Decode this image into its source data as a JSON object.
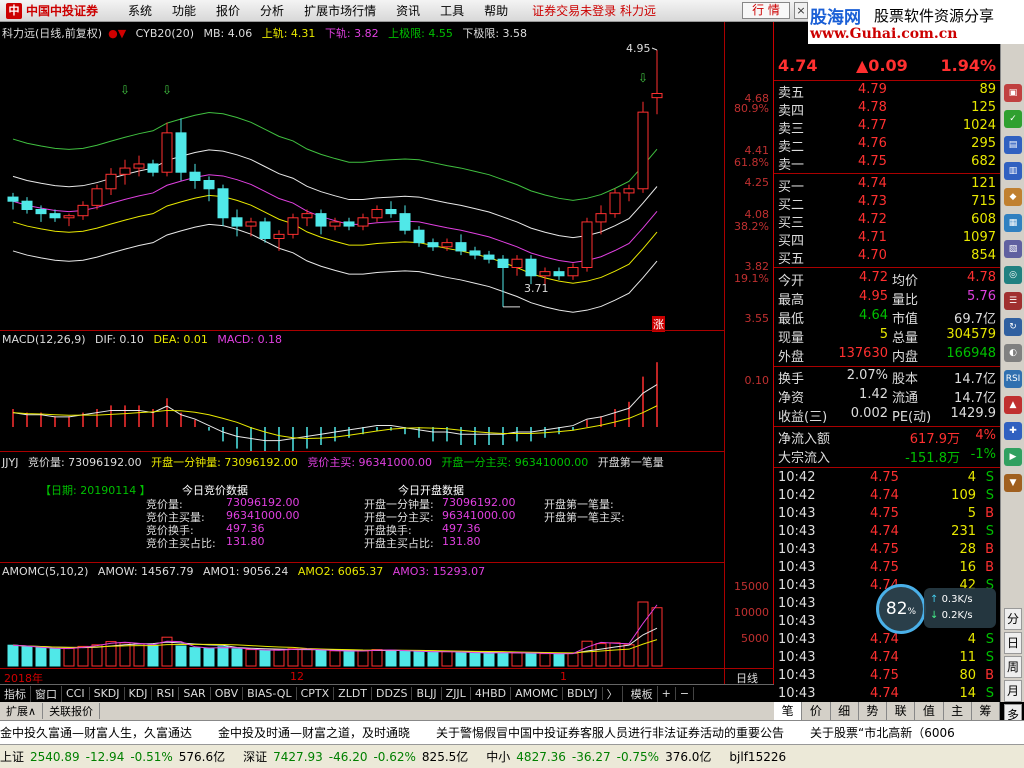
{
  "app": {
    "logo_mark": "中",
    "logo_name": "中国中投证券",
    "menus": [
      "系统",
      "功能",
      "报价",
      "分析",
      "扩展市场行情",
      "资讯",
      "工具",
      "帮助"
    ],
    "status_message": "证券交易未登录 科力远",
    "quote_button": "行 情",
    "close_button": "×"
  },
  "banner": {
    "line1": "股海网",
    "line2": "股票软件资源分享",
    "line3": "www.Guhai.com.cn"
  },
  "kline_header": {
    "title": "科力远(日线,前复权)",
    "indicator": "CYB20(20)",
    "mb": "MB: 4.06",
    "upper": "上轨: 4.31",
    "lower": "下轨: 3.82",
    "upper_limit": "上极限: 4.55",
    "lower_limit": "下极限: 3.58"
  },
  "kline_axis": {
    "labels": [
      "4.68",
      "80.9%",
      "4.41",
      "61.8%",
      "4.25",
      "4.08",
      "38.2%",
      "3.82",
      "19.1%",
      "3.55"
    ]
  },
  "kline_annotations": {
    "high_label": "4.95",
    "low_label": "3.71",
    "rise_mark": "涨"
  },
  "macd_header": {
    "name": "MACD(12,26,9)",
    "dif": "DIF: 0.10",
    "dea": "DEA: 0.01",
    "macd": "MACD: 0.18"
  },
  "macd_axis": {
    "label": "0.10"
  },
  "jjyj_header": {
    "name": "JJYJ",
    "items": [
      "竞价量: 73096192.00",
      "开盘一分钟量: 73096192.00",
      "竞价主买: 96341000.00",
      "开盘一分主买: 96341000.00",
      "开盘第一笔量"
    ]
  },
  "jjyj_panel": {
    "date_label": "【日期: 20190114  】",
    "left_title": "今日竞价数据",
    "right_title": "今日开盘数据",
    "left_rows": [
      {
        "k": "竞价量:",
        "v": "73096192.00"
      },
      {
        "k": "竞价主买量:",
        "v": "96341000.00"
      },
      {
        "k": "竞价换手:",
        "v": "497.36"
      },
      {
        "k": "竞价主买占比:",
        "v": "131.80"
      }
    ],
    "mid_rows": [
      {
        "k": "开盘一分钟量:",
        "v": "73096192.00"
      },
      {
        "k": "开盘一分主买:",
        "v": "96341000.00"
      },
      {
        "k": "开盘换手:",
        "v": "497.36"
      },
      {
        "k": "开盘主买占比:",
        "v": "131.80"
      }
    ],
    "right_rows": [
      {
        "k": "开盘第一笔量:",
        "v": ""
      },
      {
        "k": "开盘第一笔主买:",
        "v": ""
      }
    ]
  },
  "amomc_header": {
    "name": "AMOMC(5,10,2)",
    "amow": "AMOW: 14567.79",
    "amo1": "AMO1: 9056.24",
    "amo2": "AMO2: 6065.37",
    "amo3": "AMO3: 15293.07"
  },
  "amomc_axis": {
    "labels": [
      "15000",
      "10000",
      "5000"
    ]
  },
  "date_axis": {
    "left": "2018年",
    "mid": "12",
    "right": "1",
    "period": "日线"
  },
  "index_tabs": [
    "指标",
    "窗口",
    "CCI",
    "SKDJ",
    "KDJ",
    "RSI",
    "SAR",
    "OBV",
    "BIAS-QL",
    "CPTX",
    "ZLDT",
    "DDZS",
    "BLJJ",
    "ZJJL",
    "4HBD",
    "AMOMC",
    "BDLYJ",
    "〉",
    "模板",
    "+",
    "−"
  ],
  "sub_tabs": [
    "扩展∧",
    "关联报价"
  ],
  "quote": {
    "price": "4.74",
    "change": "▲0.09",
    "pct": "1.94%",
    "sells": [
      {
        "label": "卖五",
        "price": "4.79",
        "vol": "89"
      },
      {
        "label": "卖四",
        "price": "4.78",
        "vol": "125"
      },
      {
        "label": "卖三",
        "price": "4.77",
        "vol": "1024"
      },
      {
        "label": "卖二",
        "price": "4.76",
        "vol": "295"
      },
      {
        "label": "卖一",
        "price": "4.75",
        "vol": "682"
      }
    ],
    "buys": [
      {
        "label": "买一",
        "price": "4.74",
        "vol": "121"
      },
      {
        "label": "买二",
        "price": "4.73",
        "vol": "715"
      },
      {
        "label": "买三",
        "price": "4.72",
        "vol": "608"
      },
      {
        "label": "买四",
        "price": "4.71",
        "vol": "1097"
      },
      {
        "label": "买五",
        "price": "4.70",
        "vol": "854"
      }
    ],
    "stats": [
      {
        "k1": "今开",
        "v1": "4.72",
        "c1": "red",
        "k2": "均价",
        "v2": "4.78",
        "c2": "red"
      },
      {
        "k1": "最高",
        "v1": "4.95",
        "c1": "red",
        "k2": "量比",
        "v2": "5.76",
        "c2": "mag"
      },
      {
        "k1": "最低",
        "v1": "4.64",
        "c1": "grn",
        "k2": "市值",
        "v2": "69.7亿",
        "c2": "wht"
      },
      {
        "k1": "现量",
        "v1": "5",
        "c1": "yel",
        "k2": "总量",
        "v2": "304579",
        "c2": "yel"
      },
      {
        "k1": "外盘",
        "v1": "137630",
        "c1": "red",
        "k2": "内盘",
        "v2": "166948",
        "c2": "grn"
      }
    ],
    "stats2": [
      {
        "k1": "换手",
        "v1": "2.07%",
        "k2": "股本",
        "v2": "14.7亿"
      },
      {
        "k1": "净资",
        "v1": "1.42",
        "k2": "流通",
        "v2": "14.7亿"
      },
      {
        "k1": "收益(三)",
        "v1": "0.002",
        "k2": "PE(动)",
        "v2": "1429.9"
      }
    ],
    "flows": [
      {
        "k": "净流入额",
        "v": "617.9万",
        "p": "4%",
        "c": "red"
      },
      {
        "k": "大宗流入",
        "v": "-151.8万",
        "p": "-1%",
        "c": "grn"
      }
    ]
  },
  "ticks": [
    {
      "t": "10:42",
      "p": "4.75",
      "v": "4",
      "f": "S"
    },
    {
      "t": "10:42",
      "p": "4.74",
      "v": "109",
      "f": "S"
    },
    {
      "t": "10:43",
      "p": "4.75",
      "v": "5",
      "f": "B"
    },
    {
      "t": "10:43",
      "p": "4.74",
      "v": "231",
      "f": "S"
    },
    {
      "t": "10:43",
      "p": "4.75",
      "v": "28",
      "f": "B"
    },
    {
      "t": "10:43",
      "p": "4.75",
      "v": "16",
      "f": "B"
    },
    {
      "t": "10:43",
      "p": "4.74",
      "v": "42",
      "f": "S"
    },
    {
      "t": "10:43",
      "p": "",
      "v": "",
      "f": ""
    },
    {
      "t": "10:43",
      "p": "",
      "v": "",
      "f": ""
    },
    {
      "t": "10:43",
      "p": "4.74",
      "v": "4",
      "f": "S"
    },
    {
      "t": "10:43",
      "p": "4.74",
      "v": "11",
      "f": "S"
    },
    {
      "t": "10:43",
      "p": "4.75",
      "v": "80",
      "f": "B"
    },
    {
      "t": "10:43",
      "p": "4.74",
      "v": "14",
      "f": "S"
    }
  ],
  "rp_tabs": [
    "笔",
    "价",
    "细",
    "势",
    "联",
    "值",
    "主",
    "筹"
  ],
  "rtool": [
    "分",
    "日",
    "周",
    "月",
    "多"
  ],
  "speed_widget": {
    "percent": "82",
    "up": "0.3K/s",
    "down": "0.2K/s"
  },
  "ticker_news": [
    "金中投久富通—财富人生，久富通达",
    "金中投及时通—财富之道，及时通晓",
    "关于警惕假冒中国中投证券客服人员进行非法证券活动的重要公告",
    "关于股票“市北高新（6006"
  ],
  "index_bar": [
    {
      "name": "上证",
      "val": "2540.89",
      "chg": "-12.94",
      "pct": "-0.51%",
      "amt": "576.6亿"
    },
    {
      "name": "深证",
      "val": "7427.93",
      "chg": "-46.20",
      "pct": "-0.62%",
      "amt": "825.5亿"
    },
    {
      "name": "中小",
      "val": "4827.36",
      "chg": "-36.27",
      "pct": "-0.75%",
      "amt": "376.0亿"
    }
  ],
  "user_tag": "bjlf15226",
  "colors": {
    "rise": "#ff3030",
    "fall": "#50e8e8",
    "ma_white": "#e8e8e8",
    "ma_yellow": "#e8e800",
    "ma_magenta": "#e040e0",
    "ma_green": "#40c040"
  },
  "chart_data": [
    {
      "type": "candlestick",
      "title": "科力远(日线,前复权)",
      "series_name": "CYB20(20)",
      "note": "approximate daily OHLC read from chart",
      "ylim": [
        3.55,
        4.95
      ],
      "ohlc": [
        [
          4.24,
          4.26,
          4.18,
          4.22
        ],
        [
          4.22,
          4.24,
          4.16,
          4.18
        ],
        [
          4.18,
          4.2,
          4.12,
          4.16
        ],
        [
          4.16,
          4.18,
          4.12,
          4.14
        ],
        [
          4.14,
          4.16,
          4.1,
          4.15
        ],
        [
          4.15,
          4.22,
          4.13,
          4.2
        ],
        [
          4.2,
          4.3,
          4.18,
          4.28
        ],
        [
          4.28,
          4.38,
          4.25,
          4.35
        ],
        [
          4.35,
          4.42,
          4.3,
          4.38
        ],
        [
          4.38,
          4.44,
          4.34,
          4.4
        ],
        [
          4.4,
          4.42,
          4.34,
          4.36
        ],
        [
          4.36,
          4.6,
          4.34,
          4.55
        ],
        [
          4.55,
          4.62,
          4.32,
          4.36
        ],
        [
          4.36,
          4.4,
          4.28,
          4.32
        ],
        [
          4.32,
          4.34,
          4.22,
          4.28
        ],
        [
          4.28,
          4.3,
          4.1,
          4.14
        ],
        [
          4.14,
          4.18,
          4.05,
          4.1
        ],
        [
          4.1,
          4.14,
          4.05,
          4.12
        ],
        [
          4.12,
          4.14,
          4.02,
          4.04
        ],
        [
          4.04,
          4.08,
          3.98,
          4.06
        ],
        [
          4.06,
          4.16,
          4.04,
          4.14
        ],
        [
          4.14,
          4.18,
          4.1,
          4.16
        ],
        [
          4.16,
          4.18,
          4.06,
          4.1
        ],
        [
          4.1,
          4.14,
          4.08,
          4.12
        ],
        [
          4.12,
          4.14,
          4.08,
          4.1
        ],
        [
          4.1,
          4.16,
          4.08,
          4.14
        ],
        [
          4.14,
          4.2,
          4.12,
          4.18
        ],
        [
          4.18,
          4.22,
          4.14,
          4.16
        ],
        [
          4.16,
          4.2,
          4.06,
          4.08
        ],
        [
          4.08,
          4.1,
          4.0,
          4.02
        ],
        [
          4.02,
          4.04,
          3.98,
          4.0
        ],
        [
          4.0,
          4.04,
          3.98,
          4.02
        ],
        [
          4.02,
          4.06,
          3.96,
          3.98
        ],
        [
          3.98,
          4.0,
          3.94,
          3.96
        ],
        [
          3.96,
          3.98,
          3.92,
          3.94
        ],
        [
          3.94,
          3.96,
          3.71,
          3.9
        ],
        [
          3.9,
          3.96,
          3.86,
          3.94
        ],
        [
          3.94,
          3.96,
          3.82,
          3.86
        ],
        [
          3.86,
          3.9,
          3.82,
          3.88
        ],
        [
          3.88,
          3.9,
          3.84,
          3.86
        ],
        [
          3.86,
          3.92,
          3.84,
          3.9
        ],
        [
          3.9,
          4.14,
          3.88,
          4.12
        ],
        [
          4.12,
          4.2,
          4.06,
          4.16
        ],
        [
          4.16,
          4.28,
          4.14,
          4.26
        ],
        [
          4.26,
          4.3,
          4.22,
          4.28
        ],
        [
          4.28,
          4.7,
          4.26,
          4.65
        ],
        [
          4.72,
          4.95,
          4.64,
          4.74
        ]
      ]
    },
    {
      "type": "bar",
      "title": "MACD(12,26,9)",
      "series": [
        {
          "name": "MACD",
          "values": [
            0.05,
            0.04,
            0.04,
            0.03,
            0.03,
            0.04,
            0.05,
            0.06,
            0.06,
            0.06,
            0.05,
            0.08,
            0.04,
            0.02,
            -0.01,
            -0.04,
            -0.06,
            -0.07,
            -0.08,
            -0.08,
            -0.07,
            -0.06,
            -0.05,
            -0.04,
            -0.03,
            -0.02,
            -0.01,
            -0.01,
            -0.02,
            -0.03,
            -0.04,
            -0.04,
            -0.05,
            -0.05,
            -0.05,
            -0.05,
            -0.04,
            -0.04,
            -0.03,
            -0.02,
            -0.01,
            0.02,
            0.03,
            0.05,
            0.07,
            0.14,
            0.18
          ]
        }
      ]
    },
    {
      "type": "bar",
      "title": "AMOMC(5,10,2)",
      "ylim": [
        0,
        17000
      ],
      "series": [
        {
          "name": "AMOW",
          "values": [
            5200,
            4800,
            4600,
            4300,
            4400,
            4900,
            5300,
            6100,
            5800,
            5500,
            5200,
            7200,
            5000,
            4600,
            4400,
            4800,
            4300,
            4100,
            3900,
            4000,
            4300,
            4200,
            3900,
            3800,
            3700,
            3800,
            4100,
            3900,
            3800,
            3600,
            3500,
            3600,
            3400,
            3300,
            3200,
            3400,
            3300,
            3200,
            3100,
            3000,
            3200,
            6200,
            5600,
            5800,
            5300,
            16000,
            14568
          ]
        }
      ]
    }
  ]
}
